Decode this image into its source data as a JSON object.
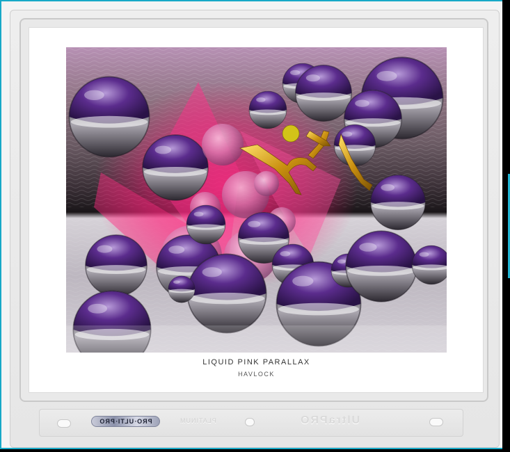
{
  "print": {
    "title": "LIQUID PINK PARALLAX",
    "artist": "HAVLOCK"
  },
  "sleeve": {
    "badge_text": "PRO·ULTI·PRO",
    "embossed_small": "PLATINUM",
    "embossed_brand": "UltraPRO"
  },
  "colors": {
    "frame_border": "#17a9c7",
    "sky_top": "#a9839f",
    "floor": "#d9d6dc",
    "sphere_purple": "#5a2a8a",
    "glow_pink": "#ff1f7a",
    "sax_gold": "#d4a418"
  }
}
